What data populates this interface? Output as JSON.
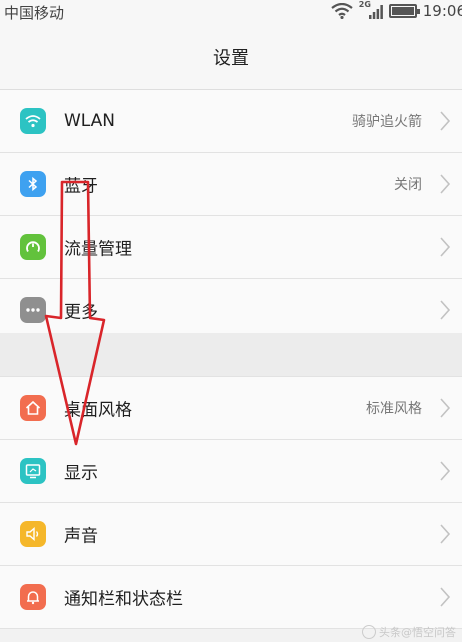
{
  "status_bar": {
    "carrier": "中国移动",
    "network_type": "2G",
    "time": "19:06"
  },
  "header": {
    "title": "设置"
  },
  "groups": [
    {
      "items": [
        {
          "label": "WLAN",
          "value": "骑驴追火箭",
          "icon": "wifi-icon",
          "icon_color": "#2cc3c3"
        },
        {
          "label": "蓝牙",
          "value": "关闭",
          "icon": "bluetooth-icon",
          "icon_color": "#3ea1f0"
        },
        {
          "label": "流量管理",
          "value": "",
          "icon": "gauge-icon",
          "icon_color": "#62c23c"
        },
        {
          "label": "更多",
          "value": "",
          "icon": "more-icon",
          "icon_color": "#8f8f8f"
        }
      ]
    },
    {
      "items": [
        {
          "label": "桌面风格",
          "value": "标准风格",
          "icon": "home-icon",
          "icon_color": "#f26d4f"
        },
        {
          "label": "显示",
          "value": "",
          "icon": "display-icon",
          "icon_color": "#2cc3c3"
        },
        {
          "label": "声音",
          "value": "",
          "icon": "speaker-icon",
          "icon_color": "#f5b72a"
        },
        {
          "label": "通知栏和状态栏",
          "value": "",
          "icon": "bell-icon",
          "icon_color": "#f26d4f"
        }
      ]
    }
  ],
  "annotation": {
    "arrow_color": "#d9252a"
  },
  "watermark": {
    "text": "头条@悟空问答"
  }
}
